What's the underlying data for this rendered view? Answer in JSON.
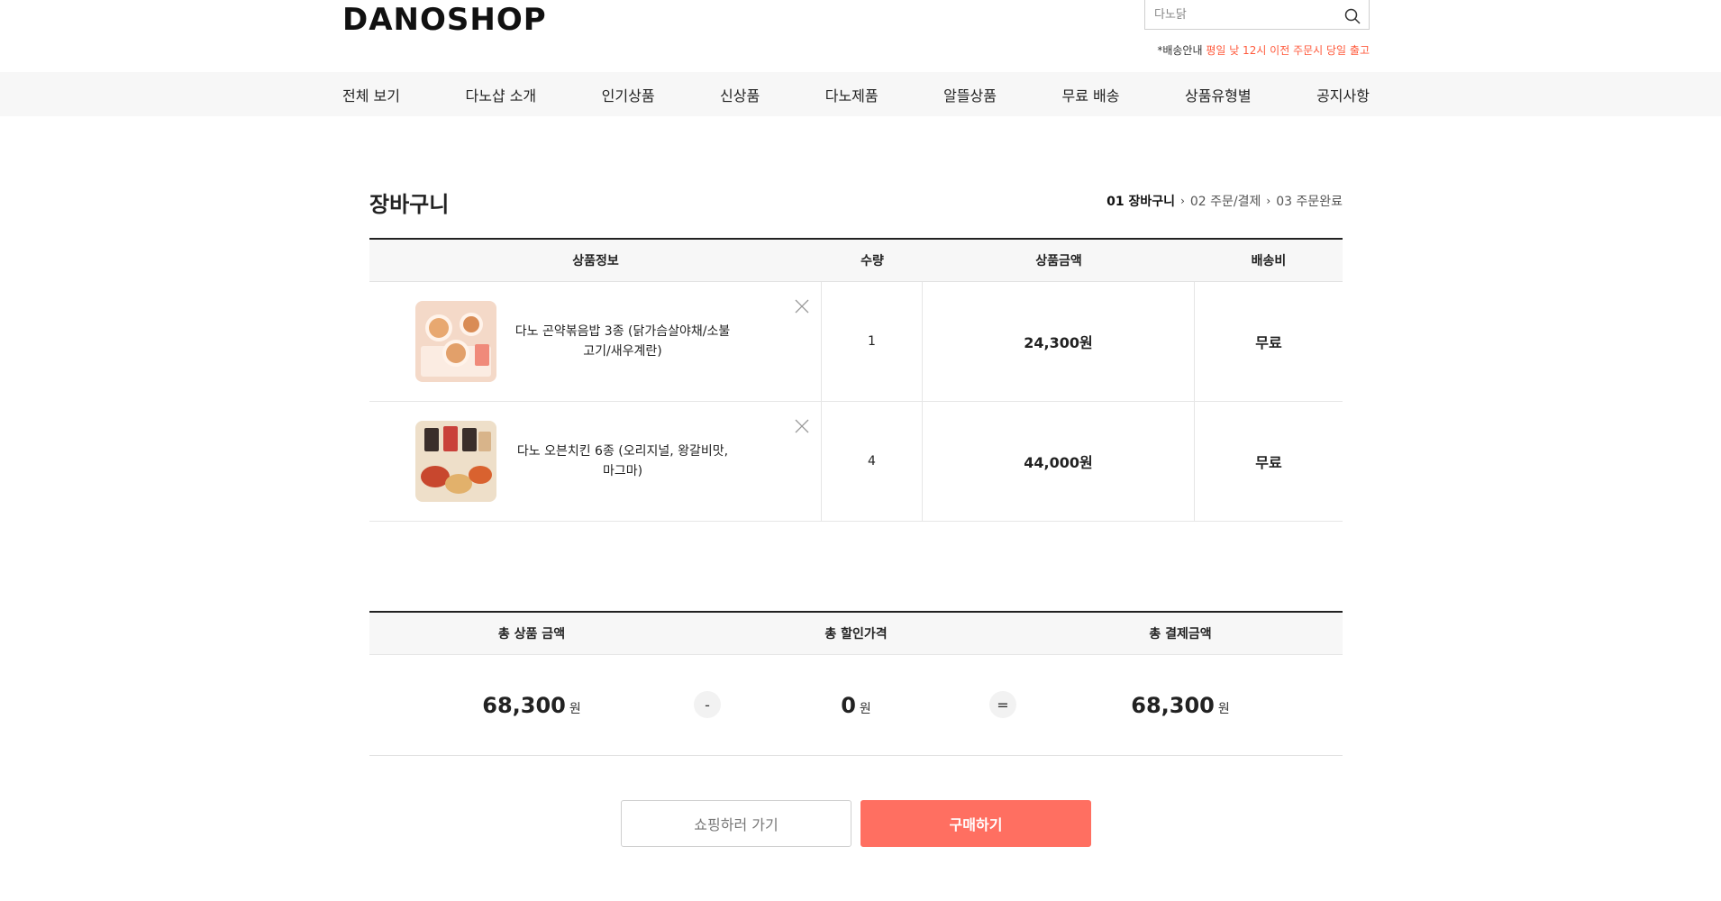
{
  "header": {
    "logo": "DANOSHOP",
    "search_placeholder": "다노닭",
    "notice_prefix": "*배송안내 ",
    "notice_highlight": "평일 낮 12시 이전 주문시 당일 출고"
  },
  "nav": {
    "items": [
      {
        "label": "전체 보기"
      },
      {
        "label": "다노샵 소개"
      },
      {
        "label": "인기상품"
      },
      {
        "label": "신상품"
      },
      {
        "label": "다노제품"
      },
      {
        "label": "알뜰상품"
      },
      {
        "label": "무료 배송"
      },
      {
        "label": "상품유형별"
      },
      {
        "label": "공지사항"
      }
    ]
  },
  "cart": {
    "title": "장바구니",
    "steps": [
      {
        "label": "01 장바구니"
      },
      {
        "label": "02 주문/결제"
      },
      {
        "label": "03 주문완료"
      }
    ],
    "columns": [
      "상품정보",
      "수량",
      "상품금액",
      "배송비"
    ],
    "items": [
      {
        "name": "다노 곤약볶음밥 3종 (닭가슴살야채/소불고기/새우계란)",
        "quantity": "1",
        "price": "24,300원",
        "shipping": "무료"
      },
      {
        "name": "다노 오븐치킨 6종 (오리지널, 왕갈비맛, 마그마)",
        "quantity": "4",
        "price": "44,000원",
        "shipping": "무료"
      }
    ]
  },
  "summary": {
    "headers": [
      "총 상품 금액",
      "총 할인가격",
      "총 결제금액"
    ],
    "total_product": "68,300",
    "total_discount": "0",
    "total_payment": "68,300",
    "unit": "원",
    "minus": "-",
    "equals": "="
  },
  "buttons": {
    "continue_shopping": "쇼핑하러 가기",
    "purchase": "구매하기"
  },
  "colors": {
    "accent": "#ff6f61",
    "notice_highlight": "#ff5a3c"
  }
}
